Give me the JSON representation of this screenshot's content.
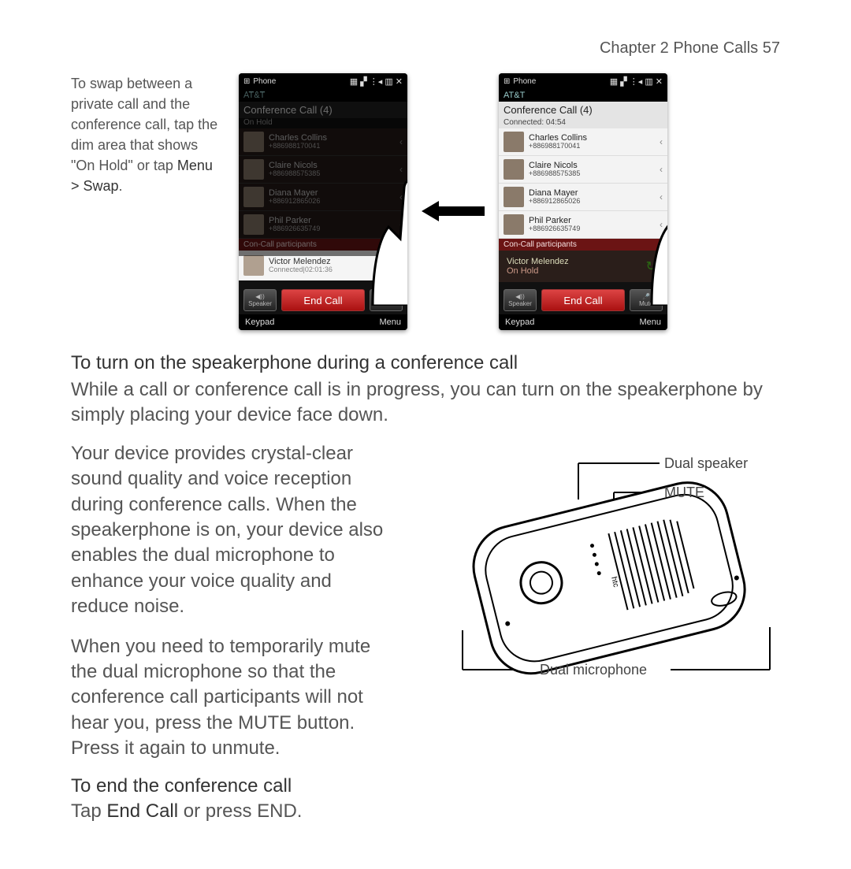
{
  "header": "Chapter 2  Phone Calls  57",
  "swap_text_1": "To swap between a private call and the conference call, tap the dim area that shows \"On Hold\" or tap ",
  "swap_text_menu": "Menu > Swap",
  "phone_common": {
    "title": "Phone",
    "carrier": "AT&T",
    "end_call": "End Call",
    "speaker": "Speaker",
    "mute": "Mute",
    "keypad": "Keypad",
    "menu": "Menu",
    "section_bar": "Con-Call participants"
  },
  "left_phone": {
    "conf_title": "Conference Call (4)",
    "conf_sub": "On Hold",
    "participants": [
      {
        "name": "Charles Collins",
        "num": "+886988170041"
      },
      {
        "name": "Claire Nicols",
        "num": "+886988575385"
      },
      {
        "name": "Diana Mayer",
        "num": "+886912865026"
      },
      {
        "name": "Phil Parker",
        "num": "+886926635749"
      }
    ],
    "active": {
      "name": "Victor Melendez",
      "sub": "Connected|02:01:36"
    }
  },
  "right_phone": {
    "conf_title": "Conference Call (4)",
    "conf_sub": "Connected: 04:54",
    "participants": [
      {
        "name": "Charles Collins",
        "num": "+886988170041"
      },
      {
        "name": "Claire Nicols",
        "num": "+886988575385"
      },
      {
        "name": "Diana Mayer",
        "num": "+886912865026"
      },
      {
        "name": "Phil Parker",
        "num": "+886926635749"
      }
    ],
    "hold": {
      "name": "Victor Melendez",
      "sub": "On Hold"
    }
  },
  "heading_speakerphone": "To turn on the speakerphone during a conference call",
  "para_speakerphone": "While a call or conference call is in progress, you can turn on the speakerphone by simply placing your device face down.",
  "para_crystal": "Your device provides crystal-clear sound quality and voice reception during conference calls. When the speakerphone is on, your device also enables the dual microphone to enhance your voice quality and reduce noise.",
  "para_mute": "When you need to temporarily mute the dual microphone so that the conference call participants will not hear you, press the MUTE button. Press it again to unmute.",
  "labels": {
    "dual_speaker": "Dual speaker",
    "mute": "MUTE",
    "dual_mic": "Dual microphone"
  },
  "heading_end": "To end the conference call",
  "para_end_1": "Tap ",
  "para_end_bold": "End Call",
  "para_end_2": " or press END."
}
